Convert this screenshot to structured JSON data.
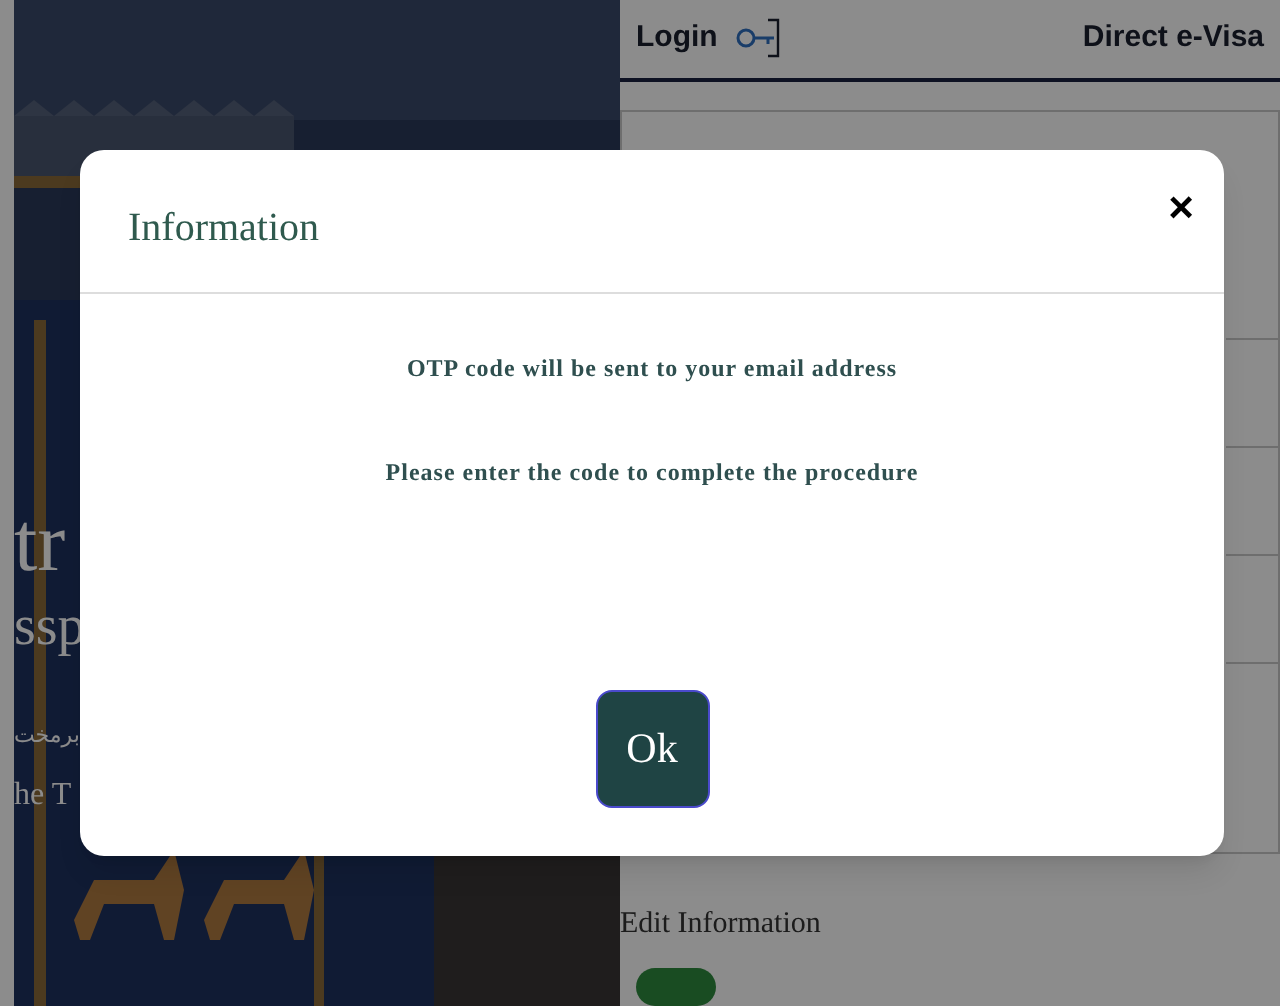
{
  "header": {
    "login": "Login",
    "direct_evisa": "Direct e-Visa"
  },
  "hero": {
    "kind": "picture",
    "texts": [
      "tr",
      "ssp",
      "برمخت",
      "he T"
    ]
  },
  "form": {
    "edit_label": "Edit Information"
  },
  "dialog": {
    "title": "Information",
    "close": "×",
    "messages": [
      "OTP code will be sent to your email address",
      "Please enter the code to complete the procedure"
    ],
    "ok_button": "Ok"
  }
}
